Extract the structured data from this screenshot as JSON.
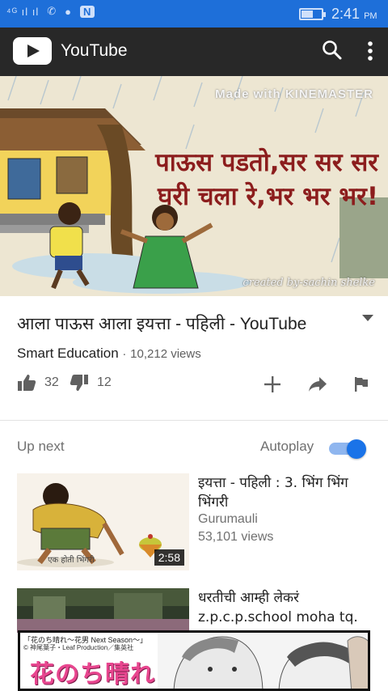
{
  "status_bar": {
    "signal_text": "⁴ᴳ ıl ıl",
    "notification_badge": "N",
    "time": "2:41",
    "ampm": "PM",
    "battery_level": 0.6
  },
  "app_bar": {
    "title": "YouTube",
    "search_icon": "search-icon",
    "more_icon": "more-vert-icon"
  },
  "player": {
    "watermark_top": "Made with KINEMASTER",
    "overlay_line1": "पाऊस पडतो,सर सर सर",
    "overlay_line2": "घरी चला रे,भर भर भर!",
    "watermark_bottom": "created by-sachin shelke"
  },
  "video": {
    "title": "आला पाऊस आला इयत्ता - पहिली - YouTube",
    "channel": "Smart Education",
    "separator": "·",
    "views": "10,212 views",
    "likes": "32",
    "dislikes": "12"
  },
  "up_next": {
    "label": "Up next",
    "autoplay_label": "Autoplay",
    "autoplay_on": true,
    "items": [
      {
        "title": "इयत्ता - पहिली : 3. भिंग भिंग भिंगरी",
        "channel": "Gurumauli",
        "views": "53,101 views",
        "duration": "2:58",
        "thumb_caption": "एक होती भिंगरी"
      },
      {
        "title": "धरतीची आम्ही लेकरं z.p.c.p.school moha tq. Parli v. Dist Beed"
      }
    ]
  },
  "ad": {
    "top_line": "「花のち晴れ〜花男 Next Season〜」",
    "sub_line": "© 神尾葉子・Leaf Production／集英社",
    "logo": "花のち晴れ"
  }
}
